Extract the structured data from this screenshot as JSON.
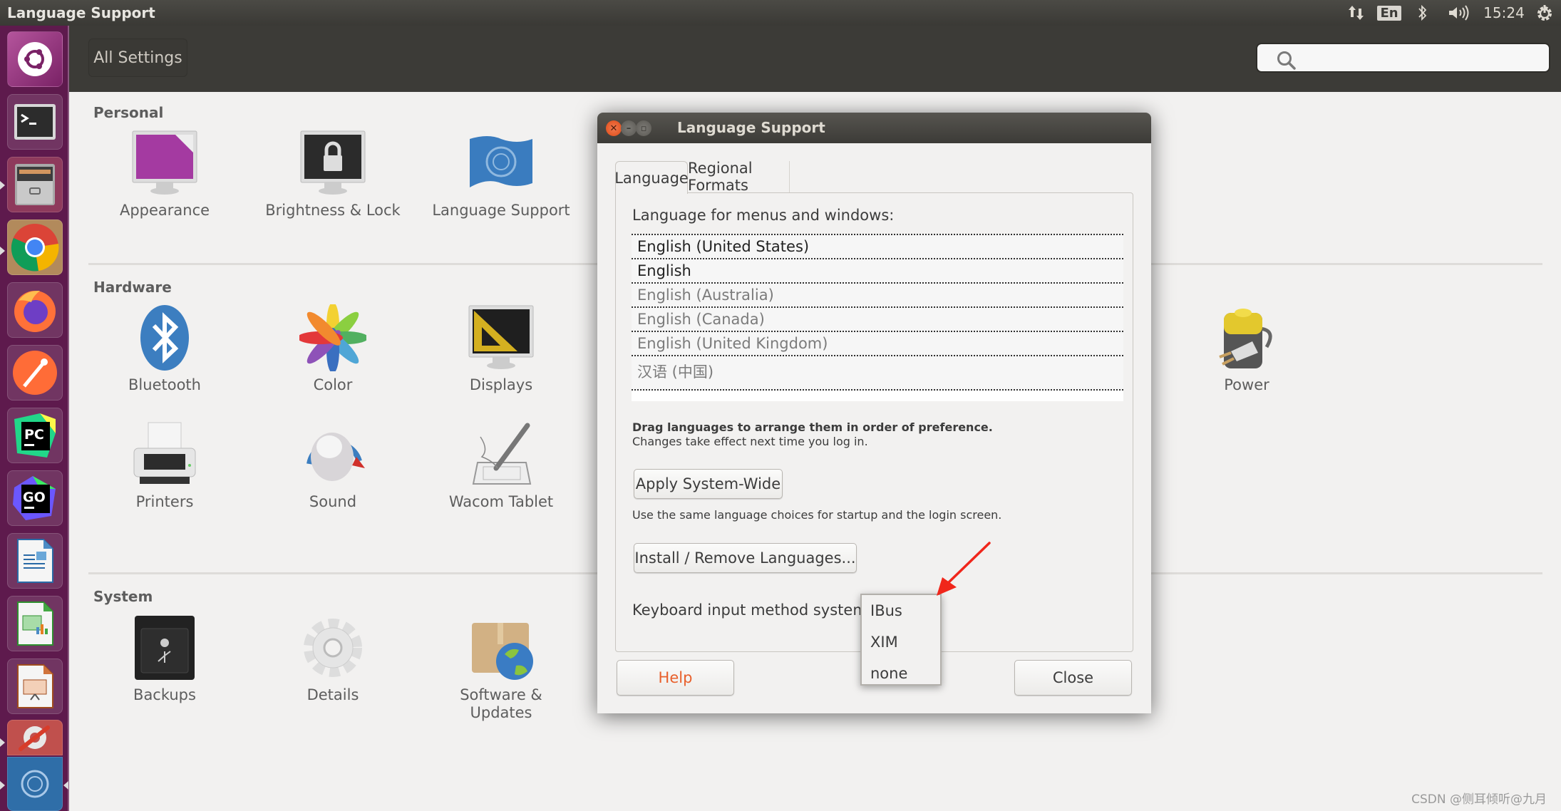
{
  "topbar": {
    "title": "Language Support",
    "indicators": {
      "network": "network-updown-icon",
      "keyboard": "En",
      "bluetooth": "bluetooth-icon",
      "volume": "volume-icon",
      "clock": "15:24",
      "session": "power-gear-icon"
    }
  },
  "launcher": {
    "items": [
      {
        "name": "ubuntu-dash",
        "icon": "ubuntu-logo-icon"
      },
      {
        "name": "terminal",
        "icon": "terminal-icon"
      },
      {
        "name": "files",
        "icon": "file-cabinet-icon",
        "running": true
      },
      {
        "name": "chrome",
        "icon": "chrome-icon",
        "running": true
      },
      {
        "name": "firefox",
        "icon": "firefox-icon"
      },
      {
        "name": "postman",
        "icon": "postman-icon"
      },
      {
        "name": "pycharm",
        "icon": "pycharm-icon",
        "label": "PC"
      },
      {
        "name": "goland",
        "icon": "goland-icon",
        "label": "GO"
      },
      {
        "name": "writer",
        "icon": "libreoffice-writer-icon"
      },
      {
        "name": "calc",
        "icon": "libreoffice-calc-icon"
      },
      {
        "name": "impress",
        "icon": "libreoffice-impress-icon"
      },
      {
        "name": "system-settings",
        "icon": "system-settings-icon",
        "running": true
      },
      {
        "name": "language-support",
        "icon": "language-support-icon",
        "running": true,
        "active": true
      }
    ]
  },
  "settings": {
    "all_settings_label": "All Settings",
    "search_placeholder": "",
    "sections": [
      {
        "title": "Personal",
        "items": [
          {
            "label": "Appearance",
            "icon": "appearance-icon"
          },
          {
            "label": "Brightness & Lock",
            "icon": "brightness-lock-icon"
          },
          {
            "label": "Language Support",
            "icon": "language-support-icon"
          }
        ]
      },
      {
        "title": "Hardware",
        "items": [
          {
            "label": "Bluetooth",
            "icon": "bluetooth-icon"
          },
          {
            "label": "Color",
            "icon": "color-icon"
          },
          {
            "label": "Displays",
            "icon": "displays-icon"
          },
          {
            "label": "Power",
            "icon": "power-icon"
          },
          {
            "label": "Printers",
            "icon": "printer-icon"
          },
          {
            "label": "Sound",
            "icon": "sound-icon"
          },
          {
            "label": "Wacom Tablet",
            "icon": "wacom-tablet-icon"
          }
        ]
      },
      {
        "title": "System",
        "items": [
          {
            "label": "Backups",
            "icon": "backups-icon"
          },
          {
            "label": "Details",
            "icon": "details-gear-icon"
          },
          {
            "label": "Software &\nUpdates",
            "icon": "software-updates-icon"
          }
        ]
      }
    ]
  },
  "dialog": {
    "title": "Language Support",
    "tabs": [
      {
        "label": "Language",
        "active": true
      },
      {
        "label": "Regional Formats",
        "active": false
      }
    ],
    "language_list_label": "Language for menus and windows:",
    "languages": [
      {
        "label": "English (United States)",
        "enabled": true
      },
      {
        "label": "English",
        "enabled": true
      },
      {
        "label": "English (Australia)",
        "enabled": false
      },
      {
        "label": "English (Canada)",
        "enabled": false
      },
      {
        "label": "English (United Kingdom)",
        "enabled": false
      },
      {
        "label": "汉语 (中国)",
        "enabled": false
      }
    ],
    "drag_hint_bold": "Drag languages to arrange them in order of preference.",
    "drag_hint": "Changes take effect next time you log in.",
    "apply_button": "Apply System-Wide",
    "apply_hint": "Use the same language choices for startup and the login screen.",
    "install_button": "Install / Remove Languages...",
    "input_method_label": "Keyboard input method system:",
    "input_method_options": [
      "IBus",
      "XIM",
      "none"
    ],
    "help_button": "Help",
    "close_button": "Close"
  },
  "colors": {
    "launcher": "#5e1a4d",
    "panel_bg": "#f2f1f0",
    "header_bg": "#3c3b37",
    "help_text": "#e8602c",
    "close_btn": "#df4a16",
    "annotation_arrow": "#f0261b"
  },
  "watermark": "CSDN @侧耳倾听@九月"
}
